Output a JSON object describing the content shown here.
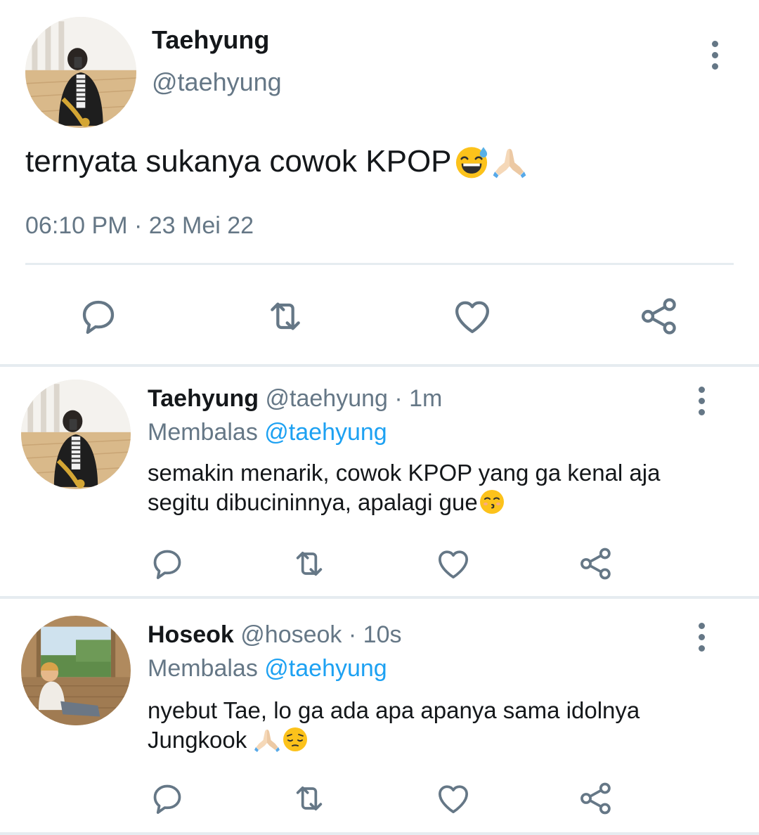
{
  "main_tweet": {
    "author_name": "Taehyung",
    "author_handle": "@taehyung",
    "text": "ternyata sukanya cowok KPOP",
    "emojis": [
      "grinning-sweat-emoji",
      "folded-hands-emoji"
    ],
    "timestamp": "06:10 PM · 23 Mei 22",
    "actions": [
      "reply-icon",
      "retweet-icon",
      "like-icon",
      "share-icon"
    ]
  },
  "replies": [
    {
      "author_name": "Taehyung",
      "author_handle": "@taehyung",
      "time": "· 1m",
      "replying_label": "Membalas",
      "replying_to": "@taehyung",
      "text_line1": "semakin menarik, cowok KPOP yang ga kenal aja",
      "text_line2": "segitu dibucininnya, apalagi gue",
      "emojis": [
        "kissing-emoji"
      ]
    },
    {
      "author_name": "Hoseok",
      "author_handle": "@hoseok",
      "time": "· 10s",
      "replying_label": "Membalas",
      "replying_to": "@taehyung",
      "text_line1": "nyebut Tae, lo ga ada apa apanya sama idolnya",
      "text_line2": "Jungkook",
      "emojis": [
        "folded-hands-emoji",
        "pensive-emoji"
      ]
    }
  ],
  "colors": {
    "text": "#14171a",
    "secondary": "#657786",
    "accent": "#1da1f2",
    "divider": "#e6ecf0"
  }
}
